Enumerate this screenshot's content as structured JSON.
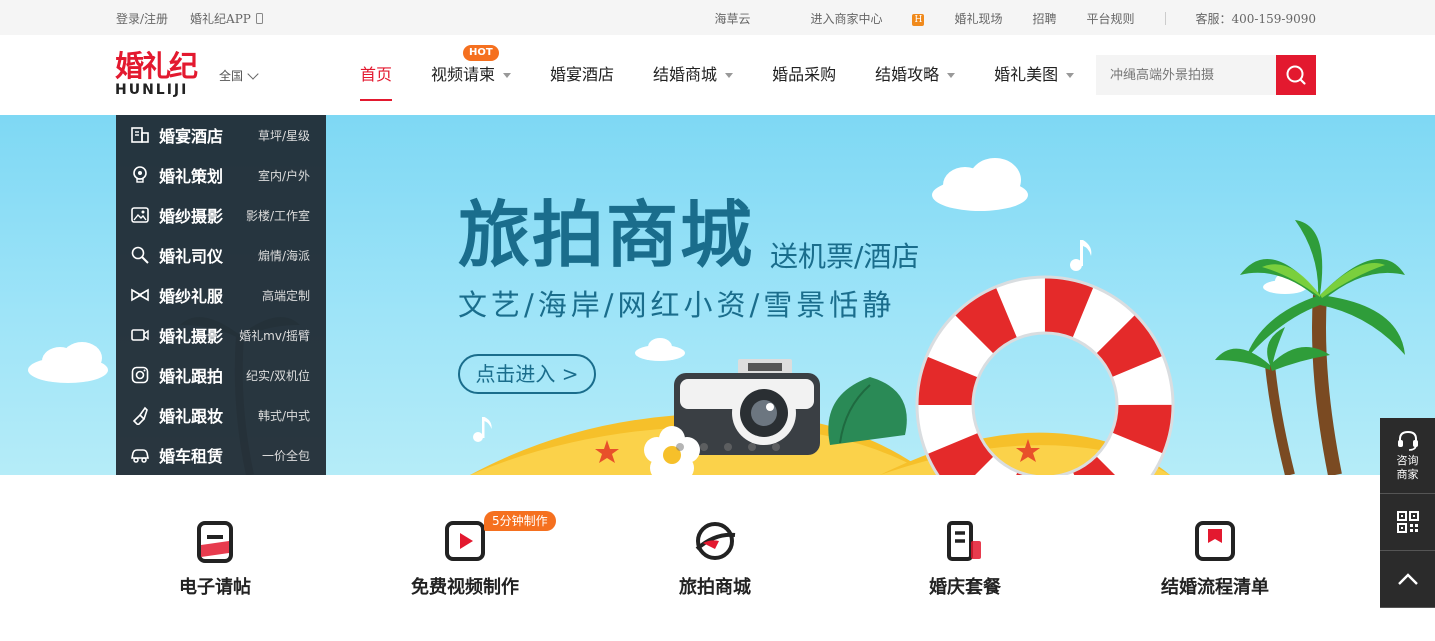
{
  "topbar": {
    "login": "登录/注册",
    "app": "婚礼纪APP",
    "links": [
      "海草云",
      "进入商家中心",
      "婚礼现场",
      "招聘",
      "平台规则"
    ],
    "merchant_badge": "H",
    "service": "客服：400-159-9090"
  },
  "header": {
    "logo_cn": "婚礼纪",
    "logo_en": "HUNLIJI",
    "region": "全国",
    "nav": [
      {
        "label": "首页",
        "active": true,
        "dropdown": false
      },
      {
        "label": "视频请柬",
        "dropdown": true,
        "badge": "HOT"
      },
      {
        "label": "婚宴酒店",
        "dropdown": false
      },
      {
        "label": "结婚商城",
        "dropdown": true
      },
      {
        "label": "婚品采购",
        "dropdown": false
      },
      {
        "label": "结婚攻略",
        "dropdown": true
      },
      {
        "label": "婚礼美图",
        "dropdown": true
      }
    ],
    "search_placeholder": "冲绳高端外景拍摄"
  },
  "categories": [
    {
      "name": "婚宴酒店",
      "sub": "草坪/星级",
      "icon": "hotel-icon"
    },
    {
      "name": "婚礼策划",
      "sub": "室内/户外",
      "icon": "lightbulb-icon"
    },
    {
      "name": "婚纱摄影",
      "sub": "影楼/工作室",
      "icon": "photo-icon"
    },
    {
      "name": "婚礼司仪",
      "sub": "煽情/海派",
      "icon": "microphone-icon"
    },
    {
      "name": "婚纱礼服",
      "sub": "高端定制",
      "icon": "bowtie-icon"
    },
    {
      "name": "婚礼摄影",
      "sub": "婚礼mv/摇臂",
      "icon": "video-camera-icon"
    },
    {
      "name": "婚礼跟拍",
      "sub": "纪实/双机位",
      "icon": "instagram-icon"
    },
    {
      "name": "婚礼跟妆",
      "sub": "韩式/中式",
      "icon": "lipstick-icon"
    },
    {
      "name": "婚车租赁",
      "sub": "一价全包",
      "icon": "car-icon"
    }
  ],
  "banner": {
    "title": "旅拍商城",
    "subtitle1": "送机票/酒店",
    "subtitle2": "文艺/海岸/网红小资/雪景恬静",
    "button": "点击进入 >",
    "slide_count": 5
  },
  "features": [
    {
      "label": "电子请帖",
      "icon": "invitation-icon"
    },
    {
      "label": "免费视频制作",
      "icon": "video-play-icon",
      "badge": "5分钟制作"
    },
    {
      "label": "旅拍商城",
      "icon": "travel-planet-icon"
    },
    {
      "label": "婚庆套餐",
      "icon": "package-icon"
    },
    {
      "label": "结婚流程清单",
      "icon": "checklist-icon"
    }
  ],
  "sidebar": {
    "consult": "咨询商家"
  },
  "colors": {
    "brand": "#e3192f",
    "accent": "#f5701f",
    "banner_text": "#1a6d8c"
  }
}
